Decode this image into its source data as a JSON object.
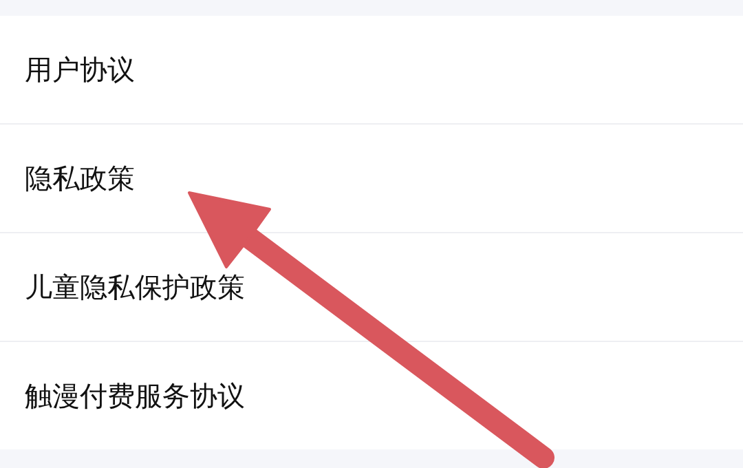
{
  "menu": {
    "items": [
      {
        "label": "用户协议"
      },
      {
        "label": "隐私政策"
      },
      {
        "label": "儿童隐私保护政策"
      },
      {
        "label": "触漫付费服务协议"
      }
    ]
  }
}
